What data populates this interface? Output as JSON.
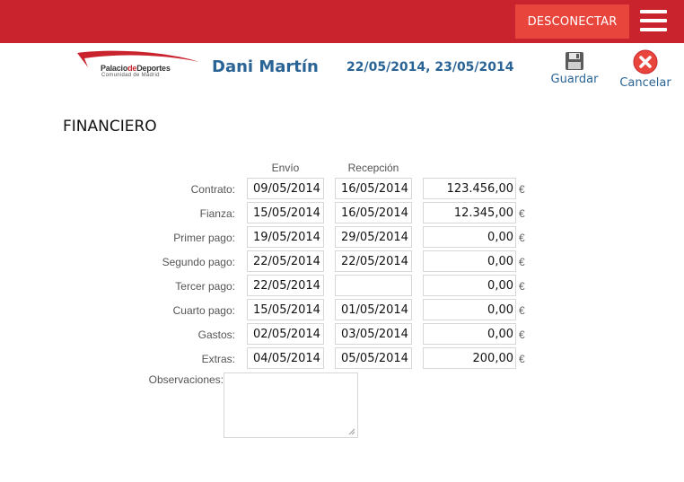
{
  "header": {
    "logout_label": "DESCONECTAR",
    "menu_icon": "hamburger-menu-icon",
    "brand_color": "#c9242d",
    "button_color": "#e8453c"
  },
  "logo": {
    "name_part1": "Palacio",
    "name_part2": "de",
    "name_part3": "Deportes",
    "subtitle": "Comunidad de Madrid"
  },
  "info": {
    "user_name": "Dani Martín",
    "dates": "22/05/2014, 23/05/2014"
  },
  "actions": {
    "save_label": "Guardar",
    "save_icon": "floppy-disk-icon",
    "cancel_label": "Cancelar",
    "cancel_icon": "close-circle-icon"
  },
  "section": {
    "title": "FINANCIERO"
  },
  "columns": {
    "envio": "Envío",
    "recepcion": "Recepción"
  },
  "currency_symbol": "€",
  "rows": [
    {
      "label": "Contrato:",
      "envio": "09/05/2014",
      "recepcion": "16/05/2014",
      "amount": "123.456,00"
    },
    {
      "label": "Fianza:",
      "envio": "15/05/2014",
      "recepcion": "16/05/2014",
      "amount": "12.345,00"
    },
    {
      "label": "Primer pago:",
      "envio": "19/05/2014",
      "recepcion": "29/05/2014",
      "amount": "0,00"
    },
    {
      "label": "Segundo pago:",
      "envio": "22/05/2014",
      "recepcion": "22/05/2014",
      "amount": "0,00"
    },
    {
      "label": "Tercer pago:",
      "envio": "22/05/2014",
      "recepcion": "",
      "amount": "0,00"
    },
    {
      "label": "Cuarto pago:",
      "envio": "15/05/2014",
      "recepcion": "01/05/2014",
      "amount": "0,00"
    },
    {
      "label": "Gastos:",
      "envio": "02/05/2014",
      "recepcion": "03/05/2014",
      "amount": "0,00"
    },
    {
      "label": "Extras:",
      "envio": "04/05/2014",
      "recepcion": "05/05/2014",
      "amount": "200,00"
    }
  ],
  "observaciones": {
    "label": "Observaciones:",
    "value": ""
  }
}
